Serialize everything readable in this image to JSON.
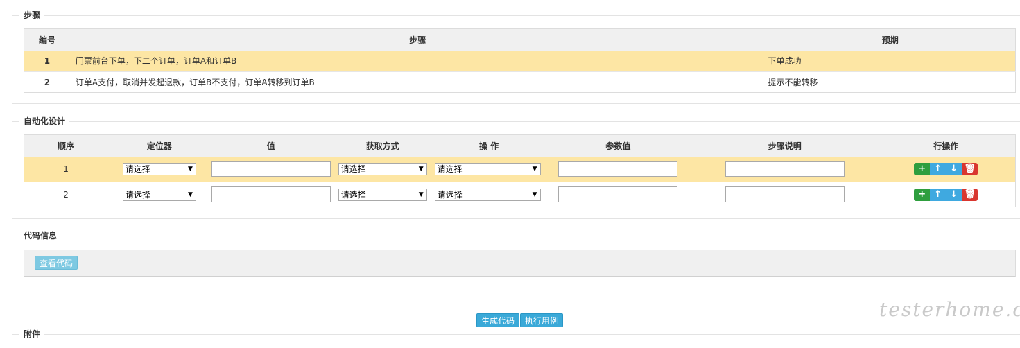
{
  "steps_section": {
    "legend": "步骤",
    "headers": [
      "编号",
      "步骤",
      "预期"
    ],
    "rows": [
      {
        "no": "1",
        "step": "门票前台下单，下二个订单，订单A和订单B",
        "expected": "下单成功"
      },
      {
        "no": "2",
        "step": "订单A支付，取消并发起退款，订单B不支付，订单A转移到订单B",
        "expected": "提示不能转移"
      }
    ]
  },
  "auto_section": {
    "legend": "自动化设计",
    "headers": [
      "顺序",
      "定位器",
      "值",
      "获取方式",
      "操 作",
      "参数值",
      "步骤说明",
      "行操作"
    ],
    "rows": [
      {
        "order": "1",
        "locator": "请选择",
        "fetch": "请选择",
        "action": "请选择"
      },
      {
        "order": "2",
        "locator": "请选择",
        "fetch": "请选择",
        "action": "请选择"
      }
    ],
    "icons": {
      "add": "plus-icon",
      "up": "arrow-up-icon",
      "down": "arrow-down-icon",
      "delete": "trash-icon"
    }
  },
  "code_section": {
    "legend": "代码信息",
    "view_code_label": "查看代码"
  },
  "actions": {
    "generate_label": "生成代码",
    "execute_label": "执行用例"
  },
  "attachment_section": {
    "legend": "附件"
  },
  "watermark": "testerhome.com",
  "colors": {
    "highlight_row": "#fde6a4",
    "header_bg": "#f0f0f0",
    "button_blue": "#3aa9d8",
    "add_green": "#2e9e3e",
    "move_blue": "#3fa9e0",
    "delete_red": "#d9362f"
  }
}
